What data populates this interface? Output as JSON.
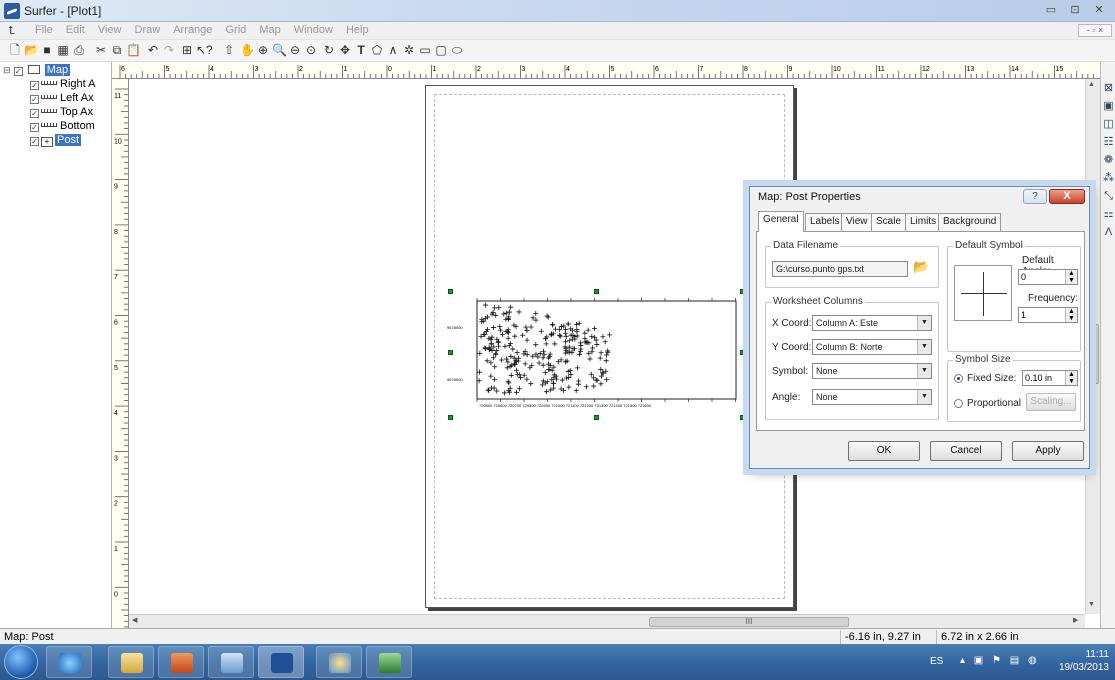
{
  "window": {
    "title": "Surfer - [Plot1]",
    "minimize": "▭",
    "maximize": "⊡",
    "close": "✕"
  },
  "menu": [
    "File",
    "Edit",
    "View",
    "Draw",
    "Arrange",
    "Grid",
    "Map",
    "Window",
    "Help"
  ],
  "toolbar": [
    "new-doc",
    "open-folder",
    "save",
    "worksheet",
    "print",
    "cut",
    "copy",
    "paste",
    "undo",
    "redo",
    "select-all",
    "help-pointer",
    "arrow",
    "hand",
    "zoom-in",
    "zoom-fit",
    "zoom-out",
    "zoom-page",
    "rotate",
    "move",
    "text",
    "polygon",
    "polyline",
    "symbol",
    "rectangle",
    "rounded-rect",
    "ellipse"
  ],
  "tree": {
    "root": "Map",
    "items": [
      "Right A",
      "Left Ax",
      "Top Ax",
      "Bottom",
      "Post"
    ]
  },
  "hruler_labels": [
    "6",
    "5",
    "4",
    "3",
    "2",
    "1",
    "0",
    "1",
    "2",
    "3",
    "4",
    "5",
    "6",
    "7",
    "8",
    "9",
    "10",
    "11",
    "12",
    "13",
    "14",
    "15"
  ],
  "vruler_labels": [
    "11",
    "10",
    "9",
    "8",
    "7",
    "6",
    "5",
    "4",
    "3",
    "2",
    "1",
    "0"
  ],
  "dialog": {
    "title": "Map: Post Properties",
    "help": "?",
    "close": "X",
    "tabs": [
      "General",
      "Labels",
      "View",
      "Scale",
      "Limits",
      "Background"
    ],
    "data_filename_label": "Data Filename",
    "data_filename": "G:\\curso.punto gps.txt",
    "worksheet_columns_label": "Worksheet Columns",
    "x_coord_label": "X Coord:",
    "x_coord": "Column A:  Este",
    "y_coord_label": "Y Coord:",
    "y_coord": "Column B:  Norte",
    "symbol_label": "Symbol:",
    "symbol": "None",
    "angle_label": "Angle:",
    "angle": "None",
    "default_symbol_label": "Default Symbol",
    "default_angle_label": "Default Angle:",
    "default_angle": "0",
    "frequency_label": "Frequency:",
    "frequency": "1",
    "symbol_size_label": "Symbol Size",
    "fixed_size_label": "Fixed Size:",
    "fixed_size": "0.10 in",
    "proportional_label": "Proportional",
    "scaling_label": "Scaling...",
    "ok": "OK",
    "cancel": "Cancel",
    "apply": "Apply"
  },
  "status": {
    "left": "Map: Post",
    "coords": "-6.16 in, 9.27 in",
    "size": "6.72 in x 2.66 in"
  },
  "taskbar": {
    "lang": "ES",
    "time": "11:11",
    "date": "19/03/2013",
    "apps": [
      "internet-explorer",
      "file-explorer",
      "office",
      "notepad",
      "surfer",
      "paint",
      "excel"
    ]
  },
  "map_axis": {
    "y_labels": [
      "9678000",
      "9678000"
    ],
    "x_labels": "720500 720600 720700 720800 720900 721000 721100 721200 721300 721400 721500 721600"
  }
}
